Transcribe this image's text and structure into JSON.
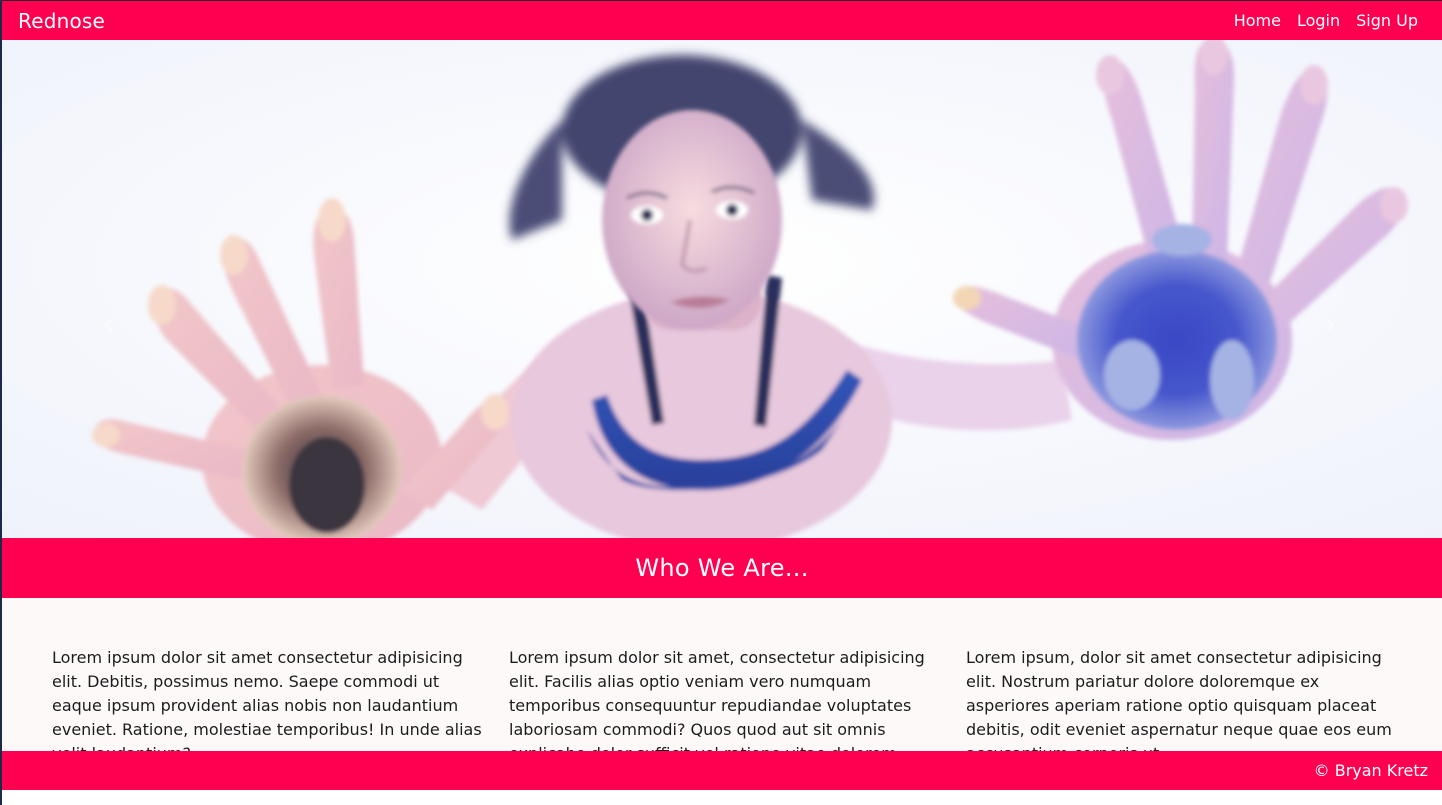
{
  "navbar": {
    "brand": "Rednose",
    "links": [
      {
        "label": "Home"
      },
      {
        "label": "Login"
      },
      {
        "label": "Sign Up"
      }
    ]
  },
  "carousel": {
    "prev_glyph": "‹",
    "next_glyph": "›",
    "image_icon": "diver-photo"
  },
  "section": {
    "title": "Who We Are..."
  },
  "columns": [
    {
      "text": "Lorem ipsum dolor sit amet consectetur adipisicing elit. Debitis, possimus nemo. Saepe commodi ut eaque ipsum provident alias nobis non laudantium eveniet. Ratione, molestiae temporibus! In unde alias velit laudantium?"
    },
    {
      "text": "Lorem ipsum dolor sit amet, consectetur adipisicing elit. Facilis alias optio veniam vero numquam temporibus consequuntur repudiandae voluptates laboriosam commodi? Quos quod aut sit omnis explicabo dolor sufficit vel ratione vitae dolorem."
    },
    {
      "text": "Lorem ipsum, dolor sit amet consectetur adipisicing elit. Nostrum pariatur dolore doloremque ex asperiores aperiam ratione optio quisquam placeat debitis, odit eveniet aspernatur neque quae eos eum accusantium corporis ut."
    }
  ],
  "footer": {
    "text": "© Bryan Kretz"
  },
  "colors": {
    "accent": "#ff0050",
    "text": "#1c1c1c",
    "background": "#fdf9f9"
  }
}
